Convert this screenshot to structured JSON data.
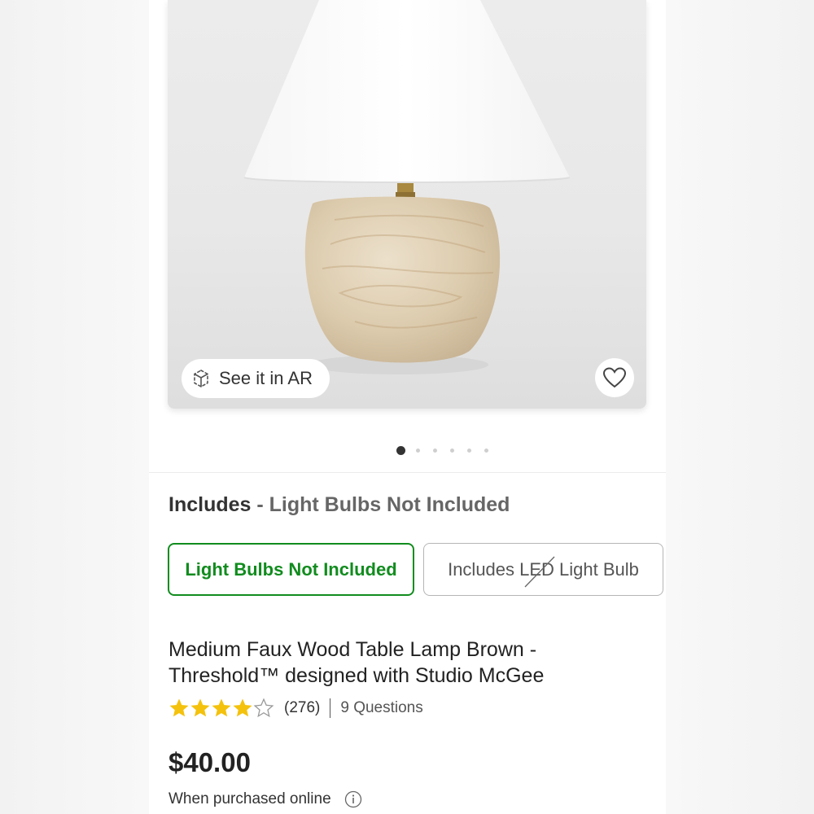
{
  "product_image": {
    "ar_button_label": "See it in AR",
    "carousel": {
      "total_images": 6,
      "active_index": 0
    }
  },
  "variation": {
    "group_label": "Includes",
    "separator": " - ",
    "selected_value": "Light Bulbs Not Included",
    "options": [
      {
        "label": "Light Bulbs Not Included",
        "selected": true,
        "available": true
      },
      {
        "label": "Includes LED Light Bulb",
        "selected": false,
        "available": false
      }
    ]
  },
  "product": {
    "title_line1": "Medium Faux Wood Table Lamp Brown -",
    "title_line2": "Threshold™ designed with Studio McGee",
    "rating": {
      "stars": 4,
      "max_stars": 5,
      "count_text": "(276)",
      "questions_text": "9 Questions"
    },
    "price": "$40.00",
    "purchase_note": "When purchased online"
  },
  "colors": {
    "accent_green": "#118c1e",
    "star_gold": "#f4c20d",
    "text_dark": "#222222",
    "option_border": "#b5b5b5"
  },
  "icons": [
    "ar-cube-icon",
    "heart-icon",
    "star-icon",
    "info-icon"
  ]
}
